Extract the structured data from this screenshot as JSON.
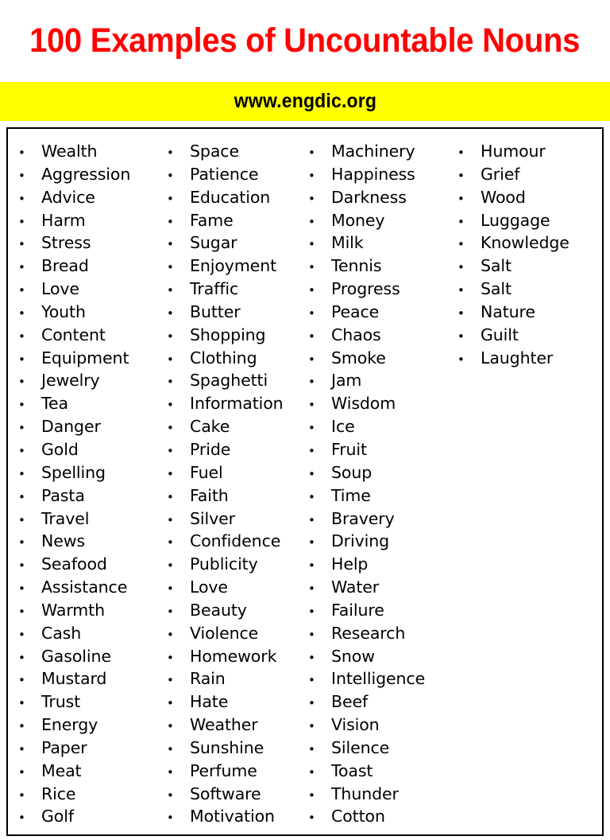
{
  "header": {
    "title": "100 Examples of Uncountable Nouns",
    "title_color": "#ff0000",
    "banner_text": "www.engdic.org",
    "banner_background": "#ffff00",
    "banner_text_color": "#000000"
  },
  "list": {
    "bullet_glyph": "•",
    "border_color": "#000000",
    "text_color": "#000000",
    "columns": [
      {
        "index": 1,
        "items": [
          "Wealth",
          "Aggression",
          "Advice",
          "Harm",
          "Stress",
          "Bread",
          "Love",
          "Youth",
          "Content",
          "Equipment",
          "Jewelry",
          "Tea",
          "Danger",
          "Gold",
          "Spelling",
          "Pasta",
          "Travel",
          "News",
          "Seafood",
          "Assistance",
          "Warmth",
          "Cash",
          "Gasoline",
          "Mustard",
          "Trust",
          "Energy",
          "Paper",
          "Meat",
          "Rice",
          "Golf"
        ]
      },
      {
        "index": 2,
        "items": [
          "Space",
          "Patience",
          "Education",
          "Fame",
          "Sugar",
          "Enjoyment",
          "Traffic",
          "Butter",
          "Shopping",
          "Clothing",
          "Spaghetti",
          "Information",
          "Cake",
          "Pride",
          "Fuel",
          "Faith",
          "Silver",
          "Confidence",
          "Publicity",
          "Love",
          "Beauty",
          "Violence",
          "Homework",
          "Rain",
          "Hate",
          "Weather",
          "Sunshine",
          "Perfume",
          "Software",
          "Motivation"
        ]
      },
      {
        "index": 3,
        "items": [
          "Machinery",
          "Happiness",
          "Darkness",
          "Money",
          "Milk",
          "Tennis",
          "Progress",
          "Peace",
          "Chaos",
          "Smoke",
          "Jam",
          "Wisdom",
          "Ice",
          "Fruit",
          "Soup",
          "Time",
          "Bravery",
          "Driving",
          "Help",
          "Water",
          "Failure",
          "Research",
          "Snow",
          "Intelligence",
          "Beef",
          "Vision",
          "Silence",
          "Toast",
          "Thunder",
          "Cotton"
        ]
      },
      {
        "index": 4,
        "items": [
          "Humour",
          "Grief",
          "Wood",
          "Luggage",
          "Knowledge",
          "Salt",
          "Salt",
          "Nature",
          "Guilt",
          "Laughter"
        ]
      }
    ]
  }
}
